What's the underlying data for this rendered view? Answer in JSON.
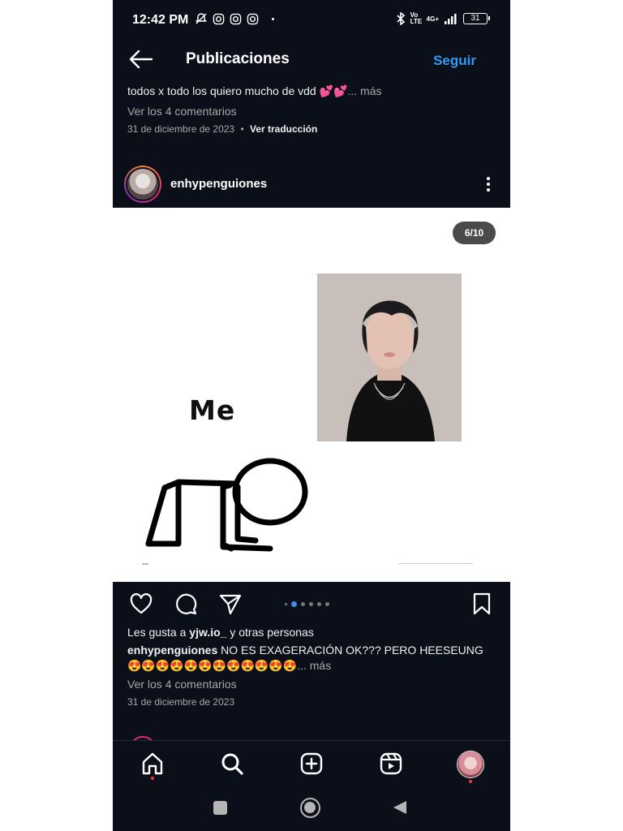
{
  "status_bar": {
    "time": "12:42 PM",
    "network_label": "4G+",
    "volte_label": "Vo LTE",
    "battery": "31",
    "icons": [
      "mute-icon",
      "instagram-icon",
      "instagram-icon",
      "instagram-icon",
      "bluetooth-icon",
      "signal-icon"
    ]
  },
  "header": {
    "title": "Publicaciones",
    "follow_label": "Seguir"
  },
  "previous_post": {
    "caption": "todos x todo los quiero mucho de vdd 💕💕",
    "more": "... más",
    "comments": "Ver los 4 comentarios",
    "date": "31 de diciembre de 2023",
    "separator": "•",
    "translate": "Ver traducción"
  },
  "post": {
    "username": "enhypenguiones",
    "counter": "6/10",
    "meme_text": "Me",
    "carousel": {
      "total_dots": 6,
      "active_index": 1
    },
    "likes_prefix": "Les gusta a ",
    "likes_user": "yjw.io_",
    "likes_suffix": " y otras personas",
    "caption_user": "enhypenguiones",
    "caption_text": " NO ES EXAGERACIÓN OK??? PERO HEESEUNG 😍😍😍😍😍😍😍😍😍😍😍😍",
    "caption_more": "... más",
    "comments": "Ver los 4 comentarios",
    "date": "31 de diciembre de 2023"
  },
  "colors": {
    "background": "#0b0f19",
    "accent": "#2f9bf5",
    "notification": "#ff3040"
  },
  "bottom_nav": [
    "home-icon",
    "search-icon",
    "create-icon",
    "reels-icon",
    "profile-avatar"
  ],
  "system_nav": [
    "recents-button",
    "home-button",
    "back-button"
  ]
}
